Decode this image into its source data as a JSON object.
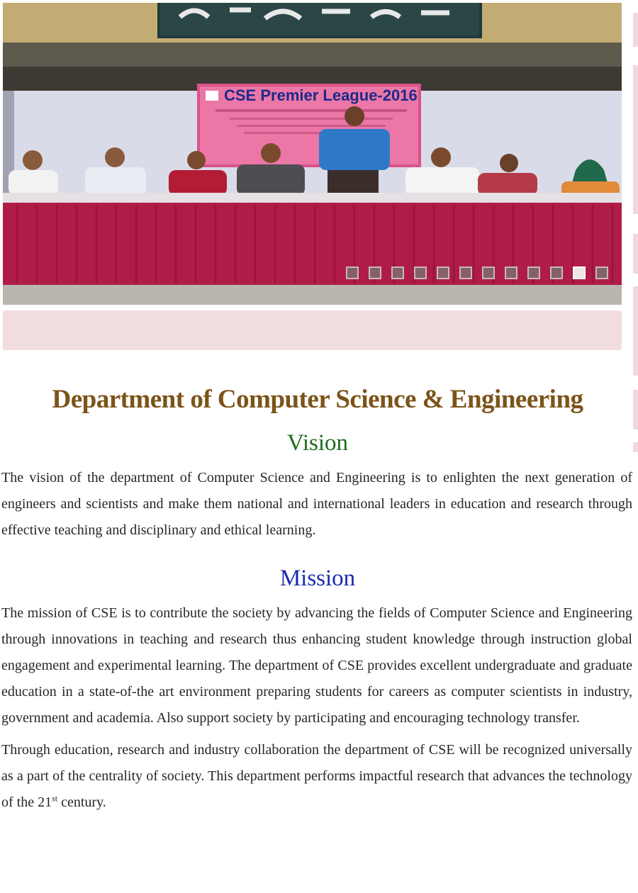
{
  "slider": {
    "banner_title": "CSE Premier League-2016",
    "slide_count": 12,
    "active_index": 10
  },
  "content": {
    "department_title": "Department of Computer Science & Engineering",
    "vision_heading": "Vision",
    "vision_text": "The vision of the department of Computer Science and Engineering is to enlighten the next generation of engineers and scientists and make them national and international leaders in education and research through effective teaching and disciplinary and ethical learning.",
    "mission_heading": "Mission",
    "mission_text_1": "The mission of CSE is to contribute the society by advancing the fields of Computer Science and Engineering through innovations in teaching and research thus enhancing student knowledge through instruction global engagement and experimental learning. The department of CSE provides excellent undergraduate and graduate education in a state-of-the art environment preparing students for careers as computer scientists in industry, government and academia. Also support society by participating and encouraging technology transfer.",
    "mission_text_2_before": "Through education, research and industry collaboration the department of CSE will be recognized universally as a part of the centrality of society. This department performs impactful research that advances the technology of the 21",
    "mission_text_2_sup": "st",
    "mission_text_2_after": " century."
  },
  "colors": {
    "title": "#7b5418",
    "vision": "#1d6b1d",
    "mission": "#1b2bb0",
    "pink_bar": "#f1dde0",
    "tablecloth": "#b01c48"
  }
}
